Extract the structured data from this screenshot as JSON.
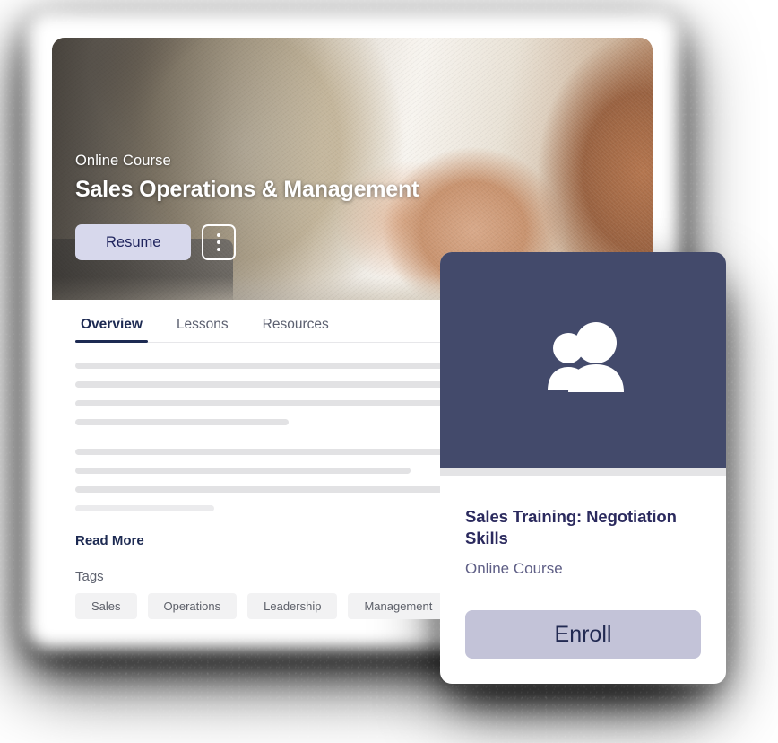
{
  "hero": {
    "kicker": "Online Course",
    "title": "Sales Operations & Management",
    "resume_label": "Resume",
    "menu_icon": "kebab-menu-icon",
    "image_description": "business-handshake-photo"
  },
  "tabs": [
    {
      "label": "Overview",
      "active": true
    },
    {
      "label": "Lessons",
      "active": false
    },
    {
      "label": "Resources",
      "active": false
    }
  ],
  "content": {
    "read_more_label": "Read More",
    "skeleton_group_one": [
      98,
      98,
      98,
      37
    ],
    "skeleton_group_two": [
      75,
      58,
      67,
      24
    ]
  },
  "tags_section": {
    "label": "Tags",
    "tags": [
      "Sales",
      "Operations",
      "Leadership",
      "Management"
    ]
  },
  "overlay_card": {
    "icon": "people-group-icon",
    "title": "Sales Training: Negotiation Skills",
    "subtitle": "Online Course",
    "enroll_label": "Enroll"
  },
  "colors": {
    "navy": "#1d2a52",
    "card_header_navy": "#434a6b",
    "lavender_button": "#d7d8ec",
    "enroll_button": "#c3c3d8",
    "title_purple": "#2b2a5e",
    "subtitle_purple": "#5f5f86",
    "tag_background": "#f2f2f3",
    "skeleton": "#e2e2e4"
  }
}
